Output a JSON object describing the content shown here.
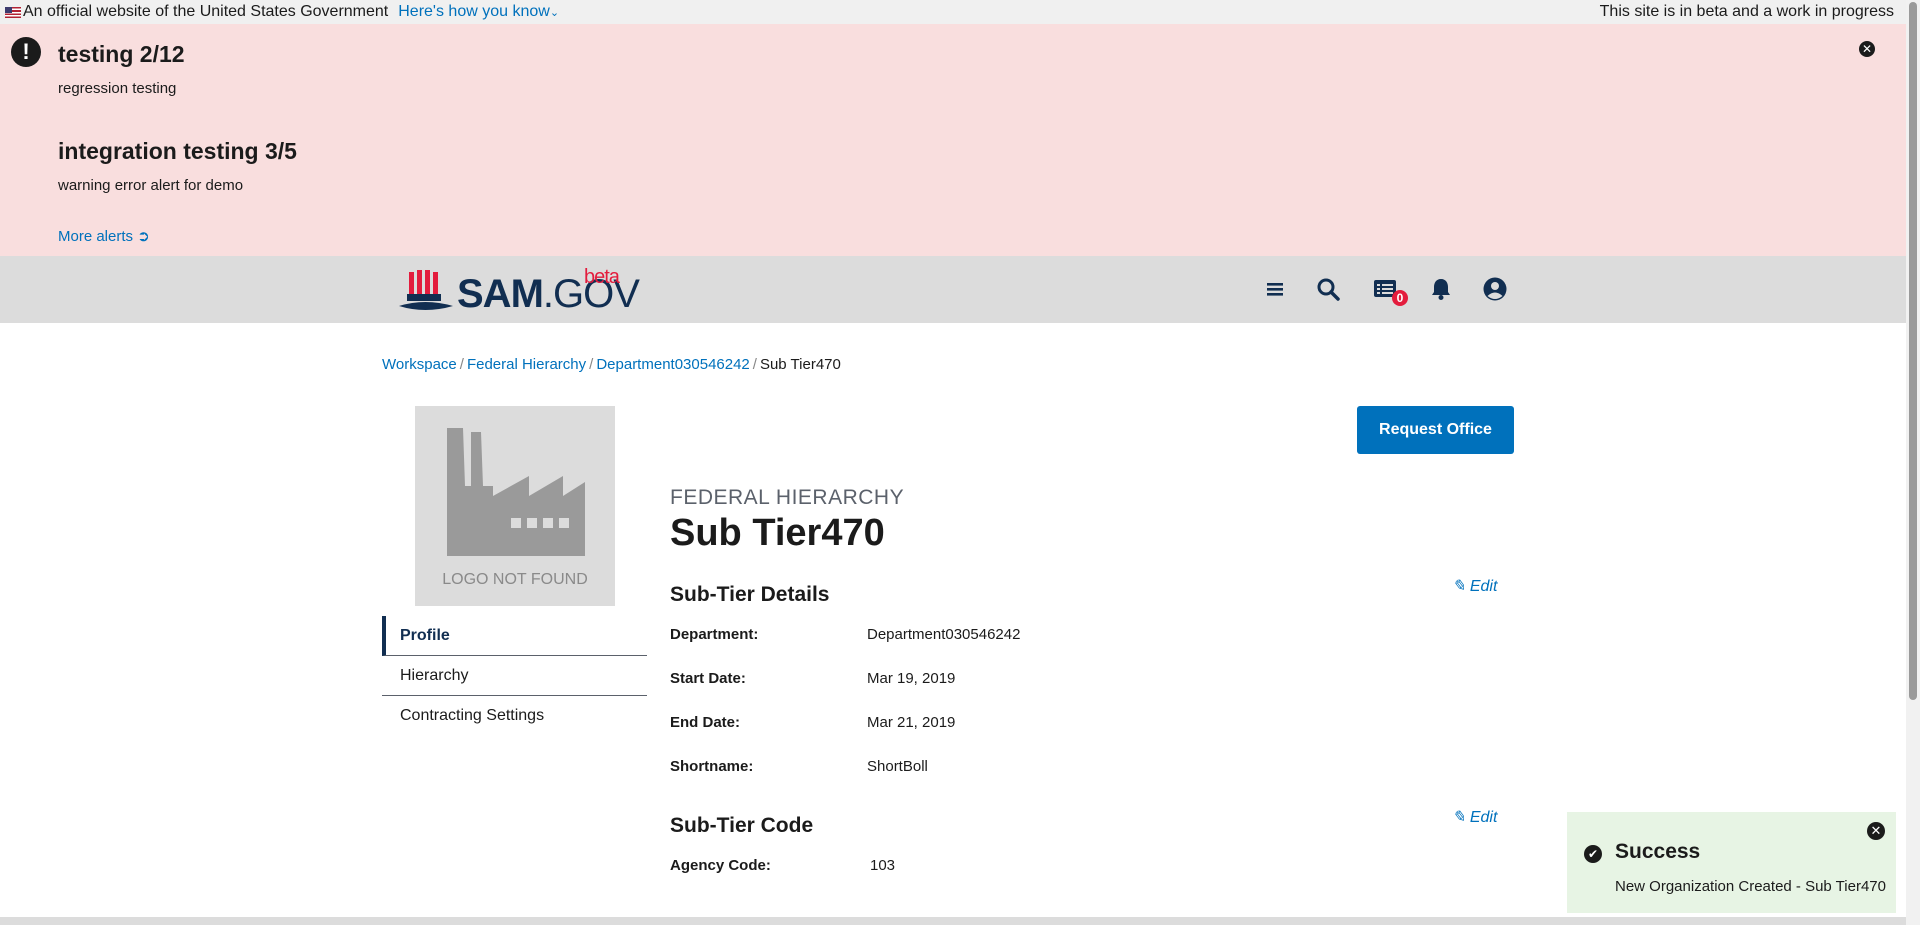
{
  "gov_banner": {
    "official_text": "An official website of the United States Government",
    "howto_label": "Here's how you know",
    "beta_note": "This site is in beta and a work in progress"
  },
  "alerts": {
    "items": [
      {
        "title": "testing 2/12",
        "body": "regression testing"
      },
      {
        "title": "integration testing 3/5",
        "body": "warning error alert for demo"
      }
    ],
    "more_label": "More alerts"
  },
  "header": {
    "logo_sam": "SAM",
    "logo_gov": ".GOV",
    "logo_beta": "beta",
    "notification_count": "0"
  },
  "breadcrumb": [
    "Workspace",
    "Federal Hierarchy",
    "Department030546242",
    "Sub Tier470"
  ],
  "logo_placeholder": "LOGO NOT FOUND",
  "sidenav": [
    "Profile",
    "Hierarchy",
    "Contracting Settings"
  ],
  "request_office_label": "Request Office",
  "eyebrow": "FEDERAL HIERARCHY",
  "page_title": "Sub Tier470",
  "subtier_details": {
    "title": "Sub-Tier Details",
    "edit_label": "Edit",
    "fields": [
      {
        "label": "Department:",
        "value": "Department030546242"
      },
      {
        "label": "Start Date:",
        "value": "Mar 19, 2019"
      },
      {
        "label": "End Date:",
        "value": "Mar 21, 2019"
      },
      {
        "label": "Shortname:",
        "value": "ShortBoll"
      }
    ]
  },
  "subtier_code": {
    "title": "Sub-Tier Code",
    "edit_label": "Edit",
    "fields": [
      {
        "label": "Agency Code:",
        "value": "103"
      }
    ]
  },
  "toast": {
    "title": "Success",
    "message": "New Organization Created - Sub Tier470"
  },
  "colors": {
    "alert_bg": "#f9dede",
    "primary": "#0071bc",
    "header_bg": "#dcdcdc",
    "toast_bg": "#e7f4e4",
    "badge": "#e31c3d"
  }
}
